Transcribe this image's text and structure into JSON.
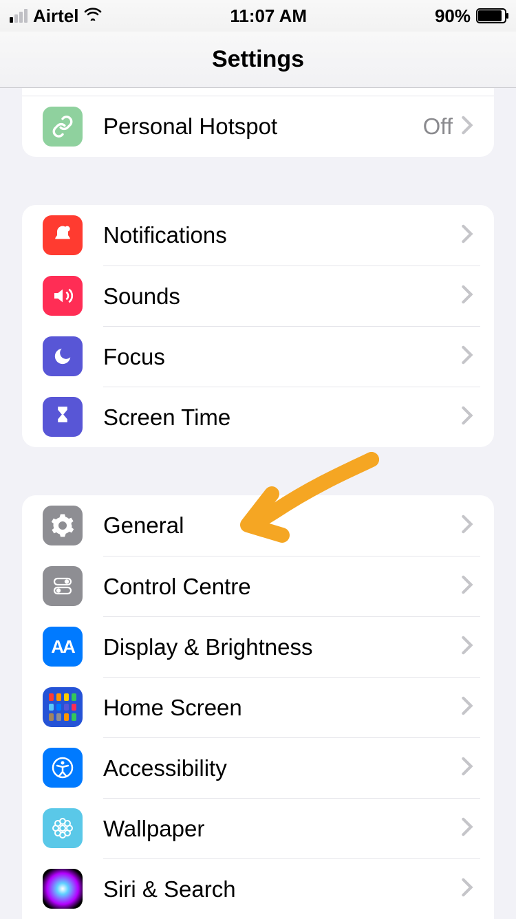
{
  "status": {
    "carrier": "Airtel",
    "time": "11:07 AM",
    "battery_pct": "90%"
  },
  "header": {
    "title": "Settings"
  },
  "groups": [
    {
      "partial_top": true,
      "items": [
        {
          "id": "personal-hotspot",
          "label": "Personal Hotspot",
          "value": "Off",
          "icon": "link-icon",
          "bg": "bg-green"
        }
      ]
    },
    {
      "items": [
        {
          "id": "notifications",
          "label": "Notifications",
          "icon": "bell-icon",
          "bg": "bg-red"
        },
        {
          "id": "sounds",
          "label": "Sounds",
          "icon": "speaker-icon",
          "bg": "bg-pink"
        },
        {
          "id": "focus",
          "label": "Focus",
          "icon": "moon-icon",
          "bg": "bg-indigo"
        },
        {
          "id": "screen-time",
          "label": "Screen Time",
          "icon": "hourglass-icon",
          "bg": "bg-indigo2"
        }
      ]
    },
    {
      "items": [
        {
          "id": "general",
          "label": "General",
          "icon": "gear-icon",
          "bg": "bg-gray"
        },
        {
          "id": "control-centre",
          "label": "Control Centre",
          "icon": "toggles-icon",
          "bg": "bg-gray2"
        },
        {
          "id": "display-brightness",
          "label": "Display & Brightness",
          "icon": "aa-icon",
          "bg": "bg-blue"
        },
        {
          "id": "home-screen",
          "label": "Home Screen",
          "icon": "apps-icon",
          "bg": "bg-home"
        },
        {
          "id": "accessibility",
          "label": "Accessibility",
          "icon": "accessibility-icon",
          "bg": "bg-blue"
        },
        {
          "id": "wallpaper",
          "label": "Wallpaper",
          "icon": "flower-icon",
          "bg": "bg-teal"
        },
        {
          "id": "siri-search",
          "label": "Siri & Search",
          "icon": "siri-icon",
          "bg": "bg-siri"
        }
      ]
    }
  ],
  "annotation": {
    "type": "arrow",
    "target": "general",
    "color": "#f5a623"
  }
}
